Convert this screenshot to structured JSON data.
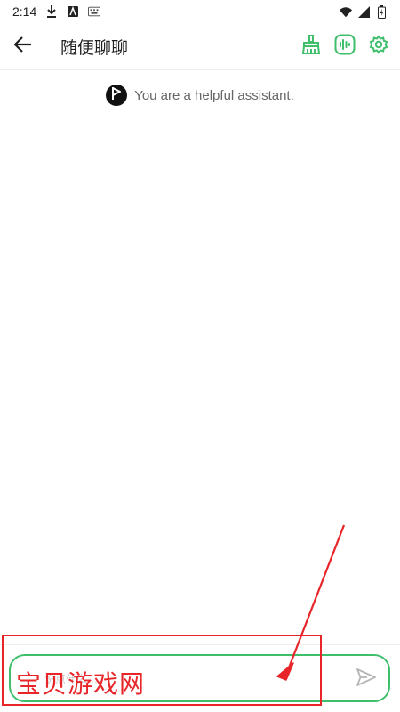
{
  "status_bar": {
    "time": "2:14",
    "icons": [
      "download-icon",
      "app-notification-icon",
      "keyboard-icon",
      "wifi-icon",
      "signal-icon",
      "battery-icon"
    ]
  },
  "header": {
    "title": "随便聊聊",
    "back_icon": "arrow-back-icon",
    "actions": [
      "clean-brush-icon",
      "voice-wave-icon",
      "settings-gear-icon"
    ]
  },
  "chat": {
    "system_message": "You are a helpful assistant."
  },
  "composer": {
    "placeholder": "说点什么…",
    "send_icon": "send-icon"
  },
  "annotation": {
    "text": "宝贝游戏网",
    "color": "#e8262a"
  },
  "colors": {
    "accent": "#3fbf6b",
    "annotation": "#e8262a"
  }
}
